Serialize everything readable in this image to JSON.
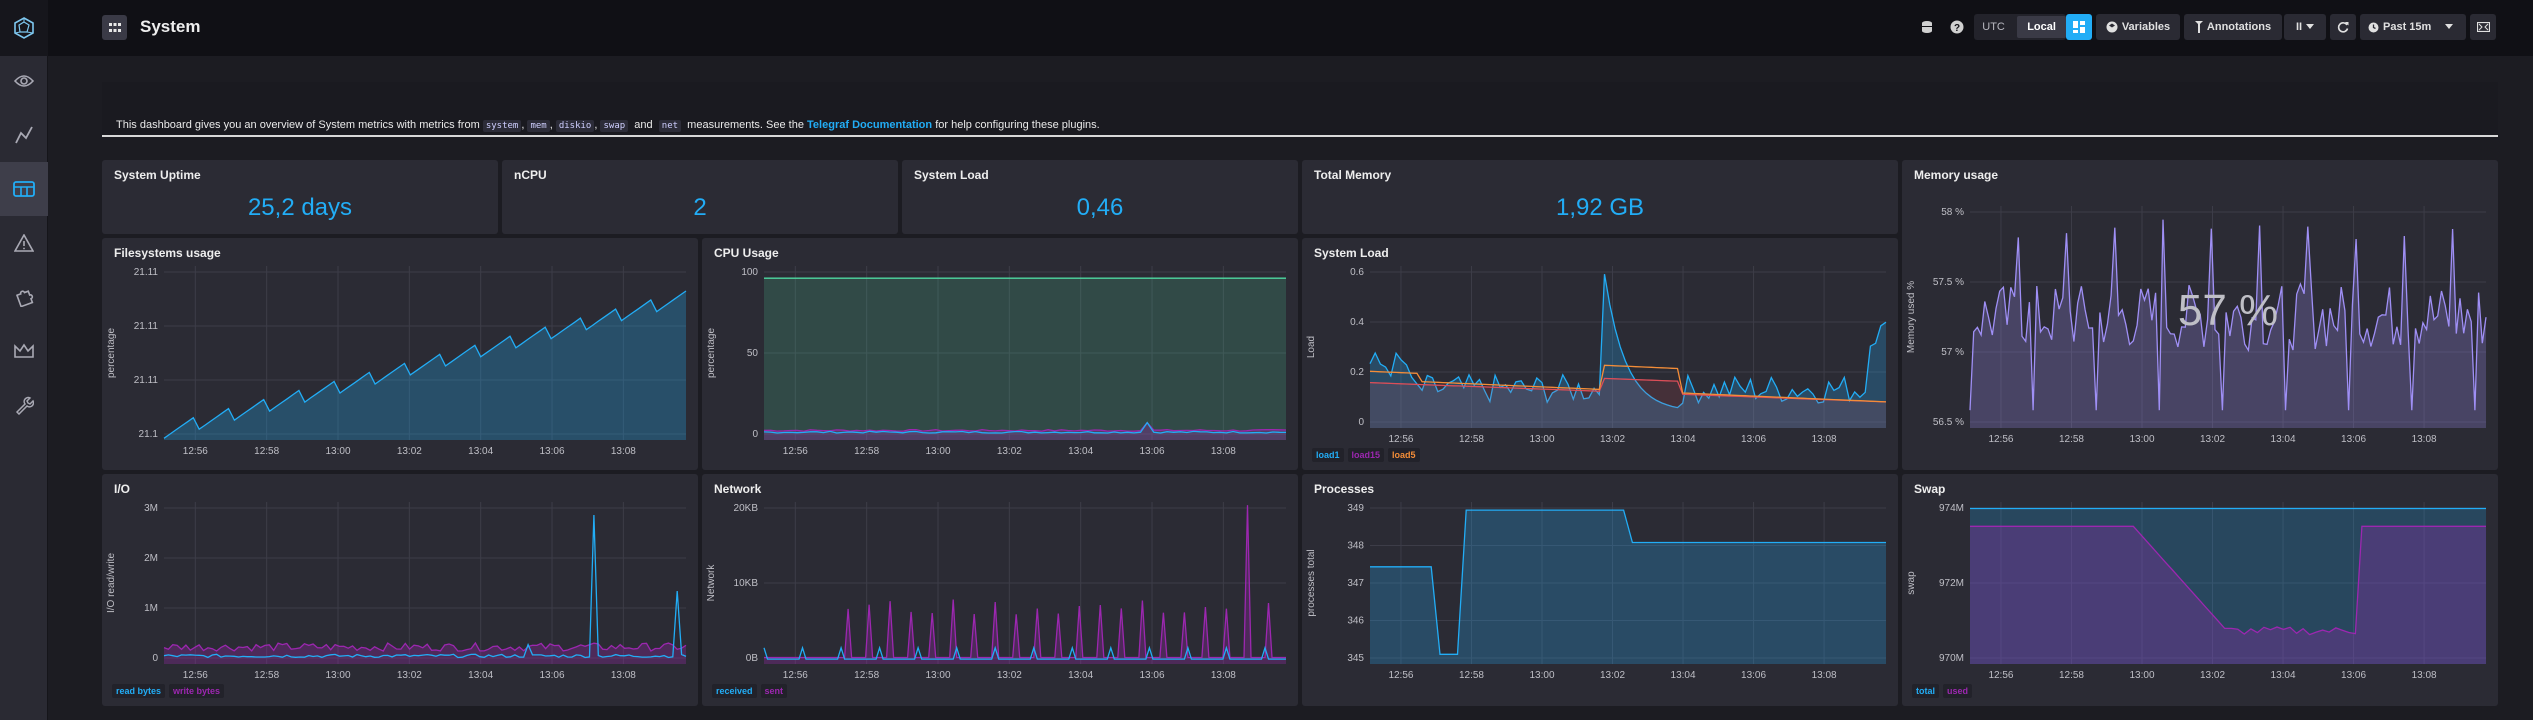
{
  "nav": {
    "items": [
      "eye-icon",
      "graph-icon",
      "dashboard-icon",
      "alert-icon",
      "puzzle-icon",
      "crown-icon",
      "wrench-icon"
    ]
  },
  "header": {
    "title": "System",
    "utc": "UTC",
    "local": "Local",
    "variables": "Variables",
    "annotations": "Annotations",
    "pause": "II",
    "time_range": "Past 15m"
  },
  "note": {
    "pre": "This dashboard gives you an overview of System metrics with metrics from",
    "m1": "system",
    "sep1": ",",
    "m2": "mem",
    "sep2": ",",
    "m3": "diskio",
    "sep3": ",",
    "m4": "swap",
    "and": "and",
    "m5": "net",
    "post": "measurements. See the",
    "link": "Telegraf Documentation",
    "end": "for help configuring these plugins."
  },
  "stats": [
    {
      "title": "System Uptime",
      "value": "25,2 days"
    },
    {
      "title": "nCPU",
      "value": "2"
    },
    {
      "title": "System Load",
      "value": "0,46"
    },
    {
      "title": "Total Memory",
      "value": "1,92 GB"
    }
  ],
  "colors": {
    "blue": "#22adf6",
    "purple": "#9c27b0",
    "orange": "#f48d38",
    "red": "#dc4e58",
    "teal": "#4ed8a0",
    "violet": "#9f8ff5"
  },
  "xticks": [
    "12:56",
    "12:58",
    "13:00",
    "13:02",
    "13:04",
    "13:06",
    "13:08"
  ],
  "graphs": {
    "fs": {
      "title": "Filesystems usage",
      "ylabel": "percentage",
      "yticks": [
        "21.11",
        "21.11",
        "21.11",
        "21.1"
      ]
    },
    "cpu": {
      "title": "CPU Usage",
      "ylabel": "percentage",
      "yticks": [
        "100",
        "50",
        "0"
      ]
    },
    "load": {
      "title": "System Load",
      "ylabel": "Load",
      "yticks": [
        "0.6",
        "0.4",
        "0.2",
        "0"
      ],
      "legend": [
        "load1",
        "load15",
        "load5"
      ]
    },
    "mem": {
      "title": "Memory usage",
      "ylabel": "Memory used %",
      "yticks": [
        "58 %",
        "57.5 %",
        "57 %",
        "56.5 %"
      ],
      "big": "57 %"
    },
    "io": {
      "title": "I/O",
      "ylabel": "I/O read/write",
      "yticks": [
        "3M",
        "2M",
        "1M",
        "0"
      ],
      "legend": [
        "read bytes",
        "write bytes"
      ]
    },
    "net": {
      "title": "Network",
      "ylabel": "Network",
      "yticks": [
        "20KB",
        "10KB",
        "0B"
      ],
      "legend": [
        "received",
        "sent"
      ]
    },
    "proc": {
      "title": "Processes",
      "ylabel": "processes total",
      "yticks": [
        "349",
        "348",
        "347",
        "346",
        "345"
      ]
    },
    "swap": {
      "title": "Swap",
      "ylabel": "swap",
      "yticks": [
        "974M",
        "972M",
        "970M"
      ],
      "legend": [
        "total",
        "used"
      ]
    }
  }
}
